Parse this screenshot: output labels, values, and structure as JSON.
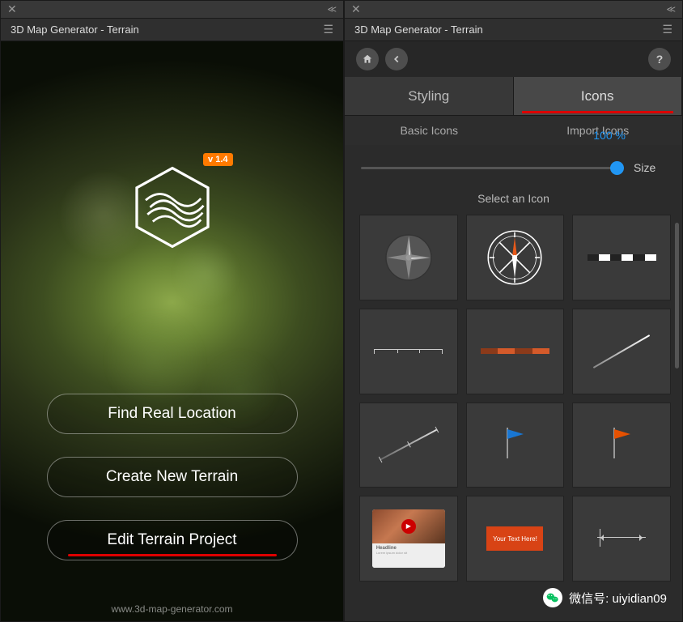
{
  "leftPanel": {
    "title": "3D Map Generator - Terrain",
    "version": "v 1.4",
    "buttons": {
      "find": "Find Real Location",
      "create": "Create New Terrain",
      "edit": "Edit Terrain Project"
    },
    "footer": "www.3d-map-generator.com"
  },
  "rightPanel": {
    "title": "3D Map Generator - Terrain",
    "tabs": {
      "styling": "Styling",
      "icons": "Icons"
    },
    "subtabs": {
      "basic": "Basic Icons",
      "import": "Import Icons"
    },
    "slider": {
      "value": "100 %",
      "label": "Size"
    },
    "selectLabel": "Select an Icon",
    "textCard": "Your Text Here!",
    "videoCard": "Headline"
  },
  "watermark": "微信号: uiyidian09"
}
